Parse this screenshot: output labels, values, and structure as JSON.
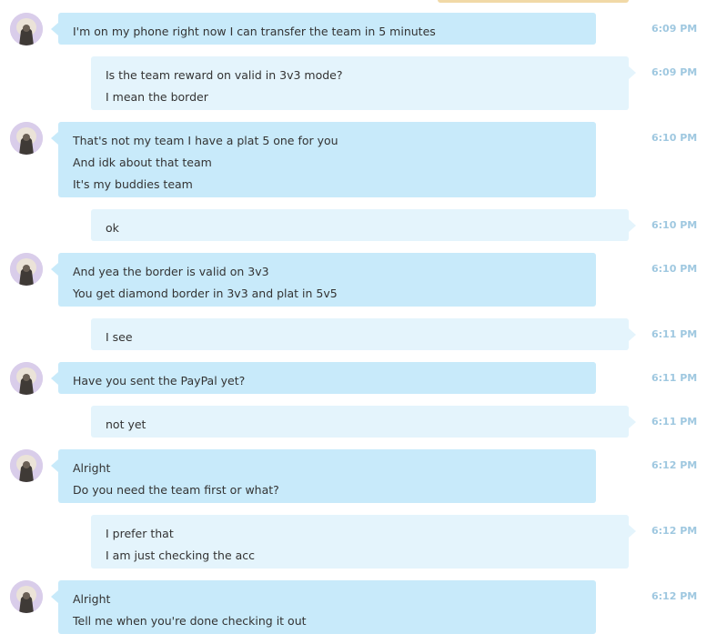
{
  "conversation": {
    "messages": [
      {
        "direction": "incoming",
        "lines": [
          "I'm on my phone right now I can transfer the team in 5 minutes"
        ],
        "time": "6:09 PM"
      },
      {
        "direction": "outgoing",
        "lines": [
          "Is the team reward on valid in 3v3 mode?",
          "I mean the border"
        ],
        "time": "6:09 PM"
      },
      {
        "direction": "incoming",
        "lines": [
          "That's not my team I have a plat 5 one for you",
          "And idk about that team",
          "It's my buddies team"
        ],
        "time": "6:10 PM"
      },
      {
        "direction": "outgoing",
        "lines": [
          "ok"
        ],
        "time": "6:10 PM"
      },
      {
        "direction": "incoming",
        "lines": [
          "And yea the border is valid on 3v3",
          "You get diamond border in 3v3 and plat in 5v5"
        ],
        "time": "6:10 PM"
      },
      {
        "direction": "outgoing",
        "lines": [
          "I see"
        ],
        "time": "6:11 PM"
      },
      {
        "direction": "incoming",
        "lines": [
          "Have you sent the PayPal yet?"
        ],
        "time": "6:11 PM"
      },
      {
        "direction": "outgoing",
        "lines": [
          "not yet"
        ],
        "time": "6:11 PM"
      },
      {
        "direction": "incoming",
        "lines": [
          "Alright",
          "Do you need the team first or what?"
        ],
        "time": "6:12 PM"
      },
      {
        "direction": "outgoing",
        "lines": [
          "I prefer that",
          "I am just checking the acc"
        ],
        "time": "6:12 PM"
      },
      {
        "direction": "incoming",
        "lines": [
          "Alright",
          "Tell me when you're done checking it out"
        ],
        "time": "6:12 PM"
      }
    ]
  },
  "colors": {
    "incoming_bubble": "#c8eafa",
    "outgoing_bubble": "#e4f4fc",
    "timestamp": "#9fc8e0",
    "message_text": "#333333"
  },
  "icons": {
    "avatar": "contact-avatar-icon"
  }
}
